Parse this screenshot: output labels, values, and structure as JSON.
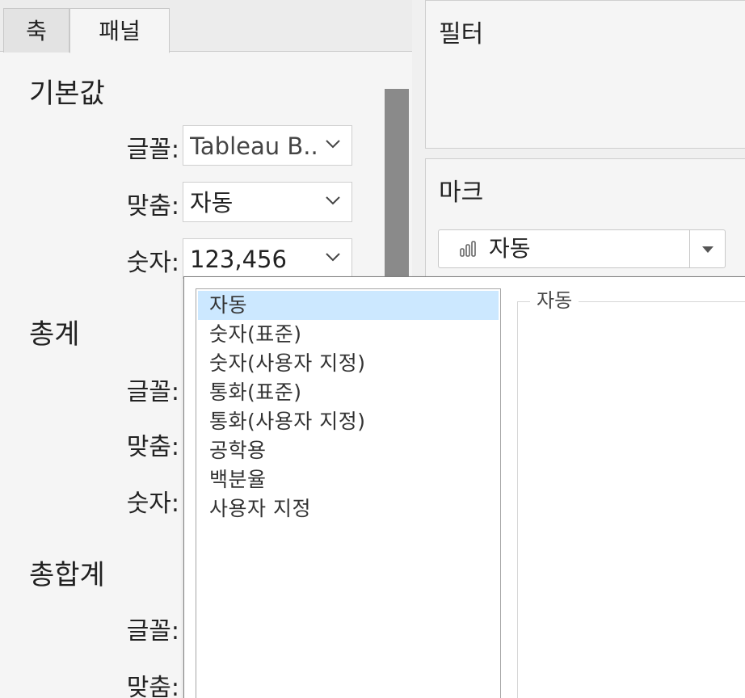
{
  "tabs": [
    {
      "label": "축"
    },
    {
      "label": "패널"
    }
  ],
  "sections": {
    "default": {
      "title": "기본값",
      "font_label": "글꼴:",
      "font_value": "Tableau B..",
      "align_label": "맞춤:",
      "align_value": "자동",
      "number_label": "숫자:",
      "number_value": "123,456"
    },
    "totals": {
      "title": "총계",
      "font_label": "글꼴:",
      "align_label": "맞춤:",
      "number_label": "숫자:"
    },
    "grand_totals": {
      "title": "총합계",
      "font_label": "글꼴:",
      "align_label": "맞춤:"
    }
  },
  "filters": {
    "title": "필터"
  },
  "marks": {
    "title": "마크",
    "type_value": "자동",
    "icon": "bar-chart-icon"
  },
  "number_format_popup": {
    "items": [
      {
        "label": "자동",
        "selected": true
      },
      {
        "label": "숫자(표준)"
      },
      {
        "label": "숫자(사용자 지정)"
      },
      {
        "label": "통화(표준)"
      },
      {
        "label": "통화(사용자 지정)"
      },
      {
        "label": "공학용"
      },
      {
        "label": "백분율"
      },
      {
        "label": "사용자 지정"
      }
    ],
    "group_title": "자동"
  },
  "colors": {
    "selection": "#cce8ff",
    "scrollbar_thumb": "#8a8a8a",
    "pane_background": "#f5f5f5"
  }
}
